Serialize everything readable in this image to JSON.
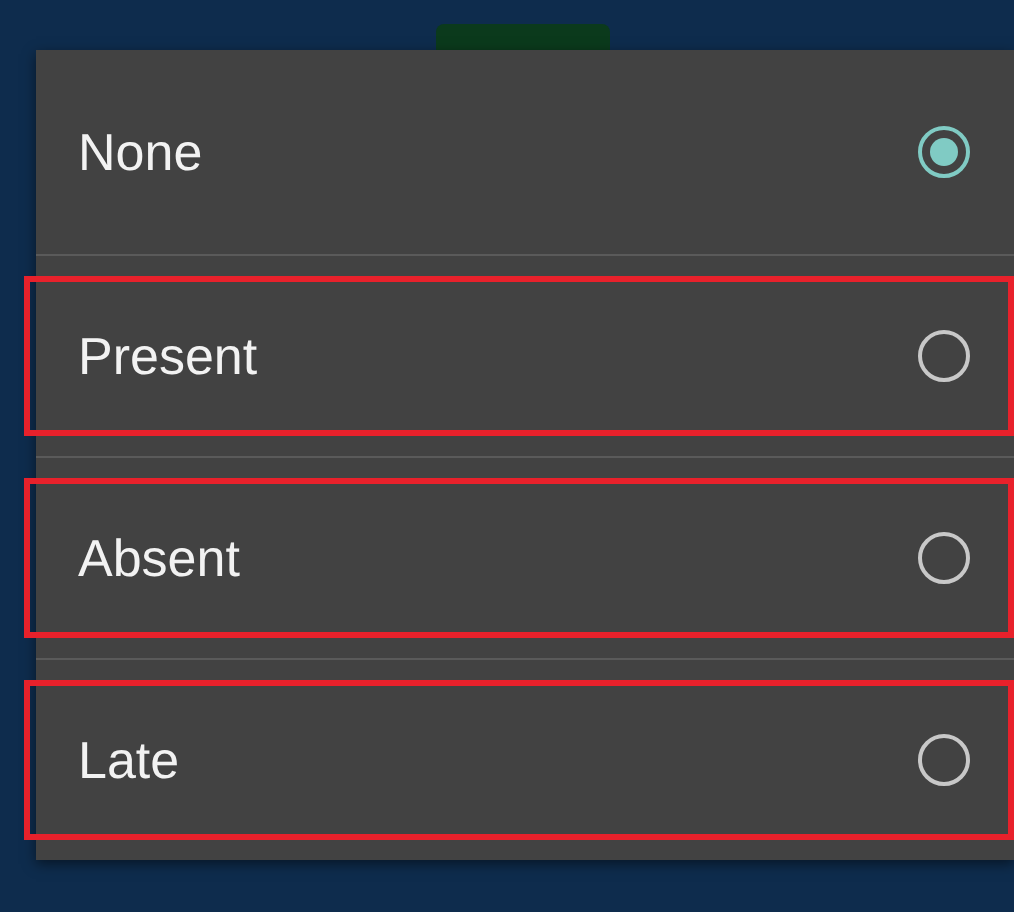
{
  "options": [
    {
      "label": "None",
      "selected": true,
      "highlighted": false
    },
    {
      "label": "Present",
      "selected": false,
      "highlighted": true
    },
    {
      "label": "Absent",
      "selected": false,
      "highlighted": true
    },
    {
      "label": "Late",
      "selected": false,
      "highlighted": true
    }
  ]
}
